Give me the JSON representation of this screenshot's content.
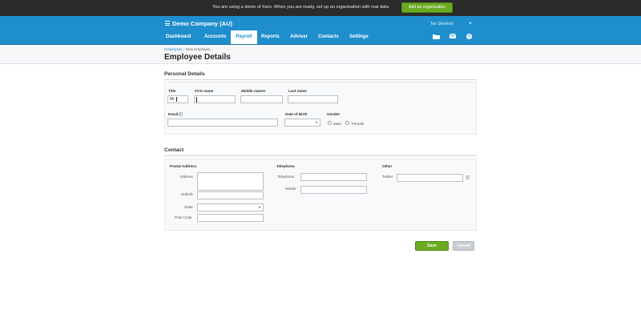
{
  "demo_banner": {
    "text": "You are using a demo of Xero. When you are ready, set up an organisation with real data.",
    "button_label": "Add an organisation"
  },
  "header": {
    "org_name": "Demo Company (AU)",
    "user_name": "Tan Sherlock",
    "nav_tabs": [
      {
        "label": "Dashboard"
      },
      {
        "label": "Accounts"
      },
      {
        "label": "Payroll",
        "active": true
      },
      {
        "label": "Reports"
      },
      {
        "label": "Adviser"
      },
      {
        "label": "Contacts"
      },
      {
        "label": "Settings"
      }
    ],
    "icons": [
      "folder-icon",
      "mail-icon",
      "help-icon"
    ]
  },
  "breadcrumb": {
    "root": "Employees",
    "separator": "›",
    "current": "New Employee"
  },
  "page_title": "Employee Details",
  "personal_details": {
    "title": "Personal Details",
    "labels": {
      "title": "Title",
      "first_name": "First name",
      "middle_names": "Middle names",
      "last_name": "Last name",
      "email": "Email",
      "dob": "Date of Birth",
      "gender": "Gender",
      "male": "Male",
      "female": "Female"
    },
    "values": {
      "title": "Mr",
      "first_name": "",
      "middle_names": "",
      "last_name": "",
      "email": "",
      "dob": ""
    }
  },
  "contact": {
    "title": "Contact",
    "postal": {
      "heading": "Postal Address",
      "address": "Address",
      "suburb": "Suburb",
      "state": "State",
      "post_code": "Post Code"
    },
    "telephone": {
      "heading": "Telephone",
      "telephone": "Telephone",
      "mobile": "Mobile"
    },
    "other": {
      "heading": "Other",
      "twitter": "Twitter"
    }
  },
  "actions": {
    "save": "Save",
    "cancel": "Cancel"
  },
  "colors": {
    "header_blue": "#1f8ecc",
    "demo_bar": "#2b2b2b",
    "green": "#6aab21",
    "grey_button": "#c9cdd1"
  }
}
